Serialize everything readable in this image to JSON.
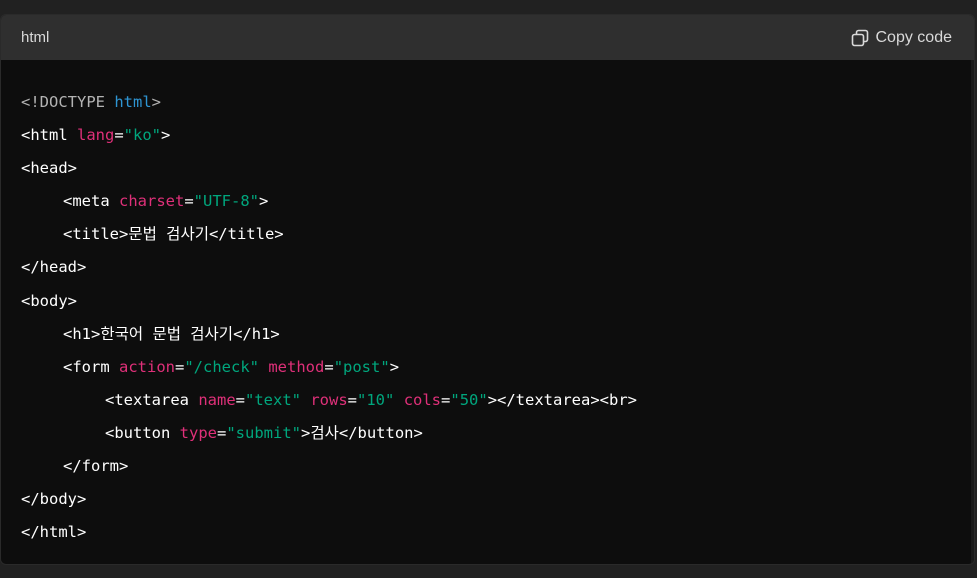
{
  "header": {
    "language": "html",
    "copy_label": "Copy code"
  },
  "code": {
    "l1": {
      "a": "<!DOCTYPE ",
      "b": "html",
      "c": ">"
    },
    "l2": {
      "a": "<html ",
      "b": "lang",
      "c": "=",
      "d": "\"ko\"",
      "e": ">"
    },
    "l3": {
      "a": "<head>"
    },
    "l4": {
      "a": "<meta ",
      "b": "charset",
      "c": "=",
      "d": "\"UTF-8\"",
      "e": ">"
    },
    "l5": {
      "a": "<title>",
      "b": "문법 검사기",
      "c": "</title>"
    },
    "l6": {
      "a": "</head>"
    },
    "l7": {
      "a": "<body>"
    },
    "l8": {
      "a": "<h1>",
      "b": "한국어 문법 검사기",
      "c": "</h1>"
    },
    "l9": {
      "a": "<form ",
      "b": "action",
      "c": "=",
      "d": "\"/check\"",
      "e": " ",
      "f": "method",
      "g": "=",
      "h": "\"post\"",
      "i": ">"
    },
    "l10": {
      "a": "<textarea ",
      "b": "name",
      "c": "=",
      "d": "\"text\"",
      "e": " ",
      "f": "rows",
      "g": "=",
      "h": "\"10\"",
      "i": " ",
      "j": "cols",
      "k": "=",
      "l": "\"50\"",
      "m": "></textarea><br>"
    },
    "l11": {
      "a": "<button ",
      "b": "type",
      "c": "=",
      "d": "\"submit\"",
      "e": ">",
      "f": "검사",
      "g": "</button>"
    },
    "l12": {
      "a": "</form>"
    },
    "l13": {
      "a": "</body>"
    },
    "l14": {
      "a": "</html>"
    }
  },
  "colors": {
    "background": "#0d0d0d",
    "header": "#2f2f2f",
    "keyword": "#2e95d3",
    "attribute": "#df3079",
    "string": "#00a67d",
    "doctype": "#b3b3b3"
  },
  "icons": {
    "copy": "copy-icon"
  }
}
